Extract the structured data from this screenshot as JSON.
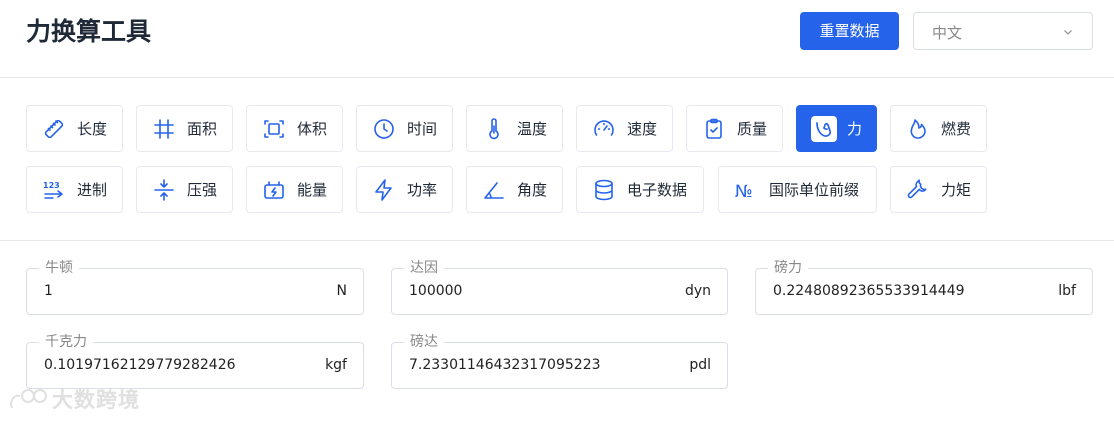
{
  "header": {
    "title": "力换算工具",
    "reset_label": "重置数据",
    "language": "中文"
  },
  "categories": [
    {
      "label": "长度",
      "icon": "ruler-icon"
    },
    {
      "label": "面积",
      "icon": "hash-icon"
    },
    {
      "label": "体积",
      "icon": "frame-icon"
    },
    {
      "label": "时间",
      "icon": "clock-icon"
    },
    {
      "label": "温度",
      "icon": "thermometer-icon"
    },
    {
      "label": "速度",
      "icon": "speedometer-icon"
    },
    {
      "label": "质量",
      "icon": "clipboard-icon"
    },
    {
      "label": "力",
      "icon": "force-icon"
    },
    {
      "label": "燃费",
      "icon": "flame-icon"
    },
    {
      "label": "进制",
      "icon": "numbers-arrow-icon"
    },
    {
      "label": "压强",
      "icon": "compress-icon"
    },
    {
      "label": "能量",
      "icon": "battery-icon"
    },
    {
      "label": "功率",
      "icon": "lightning-icon"
    },
    {
      "label": "角度",
      "icon": "angle-icon"
    },
    {
      "label": "电子数据",
      "icon": "database-icon"
    },
    {
      "label": "国际单位前缀",
      "icon": "numero-icon"
    },
    {
      "label": "力矩",
      "icon": "wrench-icon"
    }
  ],
  "active_category": "力",
  "accent_color": "#2563eb",
  "fields": [
    {
      "label": "牛顿",
      "value": "1",
      "unit": "N"
    },
    {
      "label": "达因",
      "value": "100000",
      "unit": "dyn"
    },
    {
      "label": "磅力",
      "value": "0.2248089236553391444 9",
      "unit": "lbf"
    },
    {
      "label": "千克力",
      "value": "0.10197162129779282426",
      "unit": "kgf"
    },
    {
      "label": "磅达",
      "value": "7.23301146432317095223",
      "unit": "pdl"
    }
  ],
  "watermark": {
    "text": "大数跨境"
  }
}
